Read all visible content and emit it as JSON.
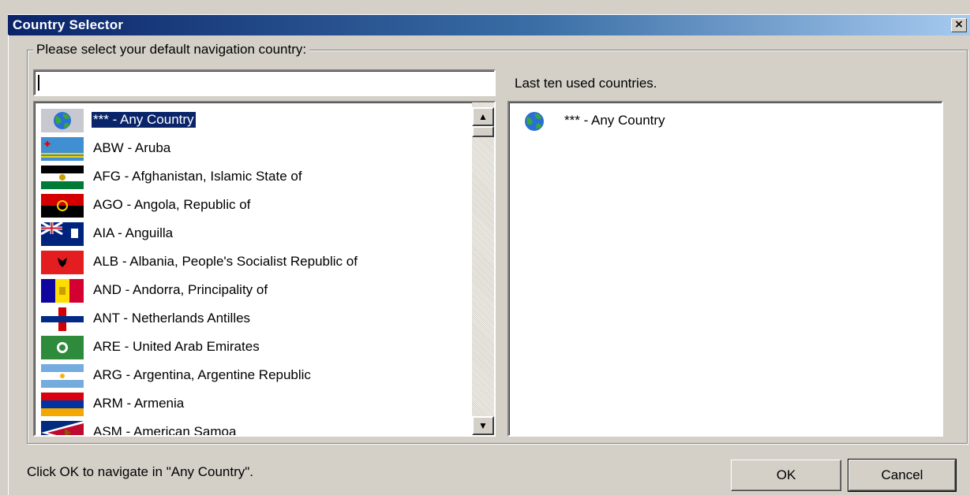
{
  "window": {
    "title": "Country Selector",
    "close_label": "×"
  },
  "group": {
    "legend": "Please select your default navigation country:"
  },
  "search": {
    "value": "",
    "placeholder": ""
  },
  "countries": [
    {
      "label": "*** - Any Country",
      "flag": "globe-icon",
      "selected": true
    },
    {
      "label": "ABW - Aruba",
      "flag": "aruba-flag-icon"
    },
    {
      "label": "AFG - Afghanistan, Islamic State of",
      "flag": "afghanistan-flag-icon"
    },
    {
      "label": "AGO - Angola, Republic of",
      "flag": "angola-flag-icon"
    },
    {
      "label": "AIA - Anguilla",
      "flag": "anguilla-flag-icon"
    },
    {
      "label": "ALB - Albania, People's Socialist Republic of",
      "flag": "albania-flag-icon"
    },
    {
      "label": "AND - Andorra, Principality of",
      "flag": "andorra-flag-icon"
    },
    {
      "label": "ANT - Netherlands Antilles",
      "flag": "netherlands-antilles-flag-icon"
    },
    {
      "label": "ARE - United Arab Emirates",
      "flag": "uae-flag-icon"
    },
    {
      "label": "ARG - Argentina, Argentine Republic",
      "flag": "argentina-flag-icon"
    },
    {
      "label": "ARM - Armenia",
      "flag": "armenia-flag-icon"
    },
    {
      "label": "ASM - American Samoa",
      "flag": "american-samoa-flag-icon"
    }
  ],
  "recent": {
    "label": "Last ten used countries.",
    "items": [
      {
        "label": "*** - Any Country",
        "flag": "globe-icon"
      }
    ]
  },
  "status": {
    "text": "Click OK to navigate in \"Any Country\"."
  },
  "buttons": {
    "ok": "OK",
    "cancel": "Cancel"
  },
  "colors": {
    "titlebar_start": "#0a246a",
    "titlebar_end": "#a6caf0",
    "selection": "#0a246a",
    "dialog_bg": "#d4d0c8"
  }
}
